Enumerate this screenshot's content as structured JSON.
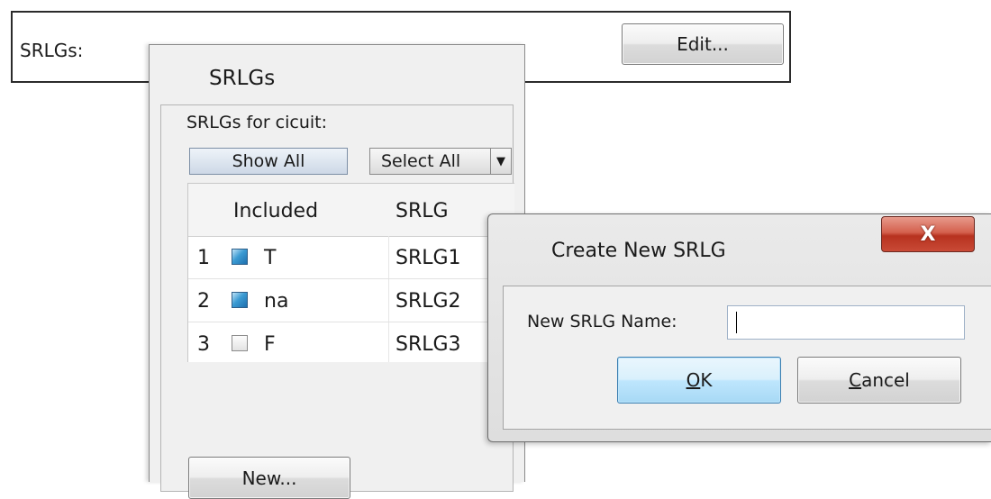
{
  "background_panel": {
    "label": "SRLGs:",
    "edit_button": "Edit..."
  },
  "srlg_dialog": {
    "title": "SRLGs",
    "for_label": "SRLGs for cicuit:",
    "show_all_button": "Show All",
    "select_all_button": "Select All",
    "columns": [
      "Included",
      "SRLG"
    ],
    "rows": [
      {
        "num": "1",
        "included": "T",
        "checked": true,
        "srlg": "SRLG1"
      },
      {
        "num": "2",
        "included": "na",
        "checked": true,
        "srlg": "SRLG2"
      },
      {
        "num": "3",
        "included": "F",
        "checked": false,
        "srlg": "SRLG3"
      }
    ],
    "new_button": "New..."
  },
  "create_dialog": {
    "title": "Create New SRLG",
    "close_glyph": "X",
    "name_label": "New SRLG Name:",
    "name_value": "",
    "ok_mnemonic": "O",
    "ok_rest": "K",
    "cancel_mnemonic": "C",
    "cancel_rest": "ancel"
  },
  "icons": {
    "select_all_dropdown": "triangle-down-icon",
    "checkbox_checked": "checkbox-checked-icon",
    "checkbox_unchecked": "checkbox-unchecked-icon"
  }
}
